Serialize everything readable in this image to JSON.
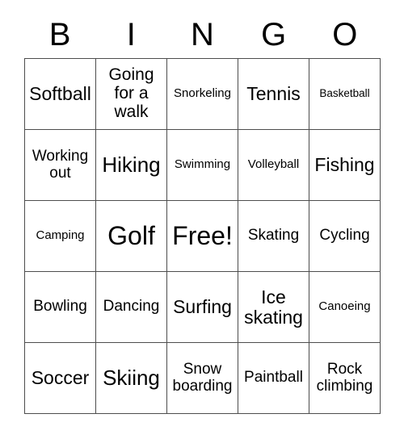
{
  "card": {
    "title": "BINGO",
    "header_letters": [
      "B",
      "I",
      "N",
      "G",
      "O"
    ],
    "border_color": "#4d4d4d",
    "cell_background": "#ffffff",
    "text_color": "#000000",
    "rows": 5,
    "columns": 5,
    "free_space": "Free!",
    "free_space_position": "center"
  },
  "cells": [
    {
      "label": "Softball",
      "size": "l"
    },
    {
      "label": "Going\nfor a\nwalk",
      "size": "m"
    },
    {
      "label": "Snorkeling",
      "size": "xs"
    },
    {
      "label": "Tennis",
      "size": "l"
    },
    {
      "label": "Basketball",
      "size": "xxs"
    },
    {
      "label": "Working\nout",
      "size": "s"
    },
    {
      "label": "Hiking",
      "size": "xl"
    },
    {
      "label": "Swimming",
      "size": "xs"
    },
    {
      "label": "Volleyball",
      "size": "xs"
    },
    {
      "label": "Fishing",
      "size": "l"
    },
    {
      "label": "Camping",
      "size": "xs"
    },
    {
      "label": "Golf",
      "size": "xxl"
    },
    {
      "label": "Free!",
      "size": "xxl"
    },
    {
      "label": "Skating",
      "size": "s"
    },
    {
      "label": "Cycling",
      "size": "s"
    },
    {
      "label": "Bowling",
      "size": "s"
    },
    {
      "label": "Dancing",
      "size": "s"
    },
    {
      "label": "Surfing",
      "size": "l"
    },
    {
      "label": "Ice\nskating",
      "size": "l"
    },
    {
      "label": "Canoeing",
      "size": "xs"
    },
    {
      "label": "Soccer",
      "size": "l"
    },
    {
      "label": "Skiing",
      "size": "xl"
    },
    {
      "label": "Snow\nboarding",
      "size": "s"
    },
    {
      "label": "Paintball",
      "size": "s"
    },
    {
      "label": "Rock\nclimbing",
      "size": "s"
    }
  ]
}
